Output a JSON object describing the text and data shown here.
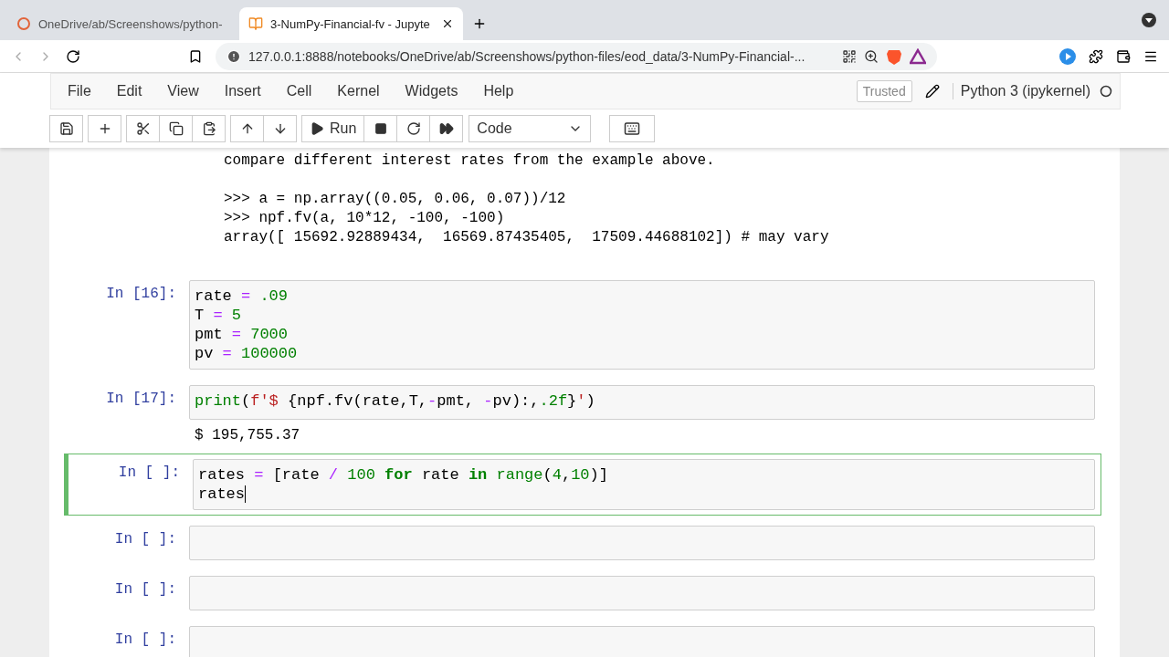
{
  "browser": {
    "tabs": [
      {
        "title": "OneDrive/ab/Screenshows/python-",
        "selected": false
      },
      {
        "title": "3-NumPy-Financial-fv - Jupyte",
        "selected": true
      }
    ],
    "address": "127.0.0.1:8888/notebooks/OneDrive/ab/Screenshows/python-files/eod_data/3-NumPy-Financial-..."
  },
  "menu": [
    "File",
    "Edit",
    "View",
    "Insert",
    "Cell",
    "Kernel",
    "Widgets",
    "Help"
  ],
  "trusted": "Trusted",
  "kernel": "Python 3 (ipykernel)",
  "toolbar": {
    "run": "Run",
    "cell_type": "Code"
  },
  "doc": {
    "intro": "compare different interest rates from the example above.",
    "lines": [
      ">>> a = np.array((0.05, 0.06, 0.07))/12",
      ">>> npf.fv(a, 10*12, -100, -100)",
      "array([ 15692.92889434,  16569.87435405,  17509.44688102]) # may vary"
    ]
  },
  "cells": [
    {
      "prompt": "In [16]:",
      "selected": false,
      "lines": [
        [
          {
            "kind": "name",
            "t": "rate "
          },
          {
            "kind": "operator",
            "t": "= "
          },
          {
            "kind": "number",
            "t": ".09"
          }
        ],
        [
          {
            "kind": "name",
            "t": "T "
          },
          {
            "kind": "operator",
            "t": "= "
          },
          {
            "kind": "number",
            "t": "5"
          }
        ],
        [
          {
            "kind": "name",
            "t": "pmt "
          },
          {
            "kind": "operator",
            "t": "= "
          },
          {
            "kind": "number",
            "t": "7000"
          }
        ],
        [
          {
            "kind": "name",
            "t": "pv "
          },
          {
            "kind": "operator",
            "t": "= "
          },
          {
            "kind": "number",
            "t": "100000"
          }
        ]
      ]
    },
    {
      "prompt": "In [17]:",
      "selected": false,
      "lines": [
        [
          {
            "kind": "builtin",
            "t": "print"
          },
          {
            "kind": "name",
            "t": "("
          },
          {
            "kind": "string",
            "t": "f'$ "
          },
          {
            "kind": "name",
            "t": "{npf.fv(rate,T,"
          },
          {
            "kind": "operator",
            "t": "-"
          },
          {
            "kind": "name",
            "t": "pmt, "
          },
          {
            "kind": "operator",
            "t": "-"
          },
          {
            "kind": "name",
            "t": "pv):,"
          },
          {
            "kind": "number",
            "t": ".2f"
          },
          {
            "kind": "name",
            "t": "}"
          },
          {
            "kind": "string",
            "t": "'"
          },
          {
            "kind": "name",
            "t": ")"
          }
        ]
      ],
      "output": "$ 195,755.37"
    },
    {
      "prompt": "In [ ]:",
      "selected": true,
      "lines": [
        [
          {
            "kind": "name",
            "t": "rates "
          },
          {
            "kind": "operator",
            "t": "= "
          },
          {
            "kind": "name",
            "t": "[rate "
          },
          {
            "kind": "operator",
            "t": "/ "
          },
          {
            "kind": "number",
            "t": "100 "
          },
          {
            "kind": "keyword",
            "t": "for "
          },
          {
            "kind": "name",
            "t": "rate "
          },
          {
            "kind": "keyword",
            "t": "in "
          },
          {
            "kind": "builtin",
            "t": "range"
          },
          {
            "kind": "name",
            "t": "("
          },
          {
            "kind": "number",
            "t": "4"
          },
          {
            "kind": "name",
            "t": ","
          },
          {
            "kind": "number",
            "t": "10"
          },
          {
            "kind": "name",
            "t": ")]"
          }
        ],
        [
          {
            "kind": "name",
            "t": "rates"
          }
        ]
      ]
    },
    {
      "prompt": "In [ ]:",
      "selected": false
    },
    {
      "prompt": "In [ ]:",
      "selected": false
    },
    {
      "prompt": "In [ ]:",
      "selected": false
    }
  ]
}
